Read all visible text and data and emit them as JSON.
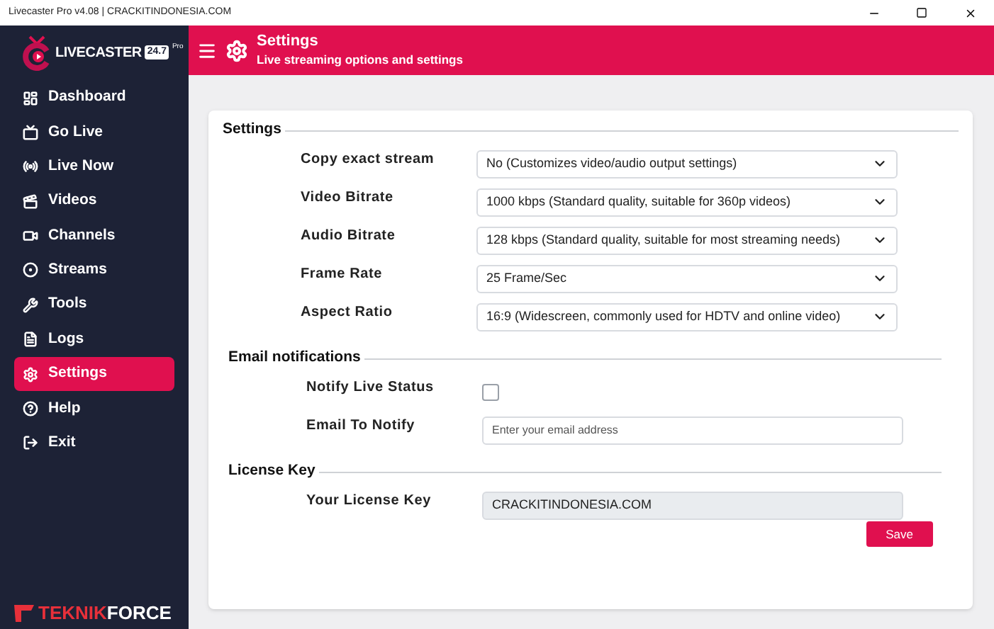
{
  "window": {
    "title": "Livecaster Pro v4.08 | CRACKITINDONESIA.COM"
  },
  "logo": {
    "name": "LIVECASTER",
    "badge": "24.7",
    "tag": "Pro"
  },
  "header": {
    "title": "Settings",
    "subtitle": "Live streaming options and settings"
  },
  "sidebar": {
    "items": [
      {
        "label": "Dashboard",
        "kind": "dashboard",
        "selected": false
      },
      {
        "label": "Go Live",
        "kind": "golive",
        "selected": false
      },
      {
        "label": "Live Now",
        "kind": "livenow",
        "selected": false
      },
      {
        "label": "Videos",
        "kind": "videos",
        "selected": false
      },
      {
        "label": "Channels",
        "kind": "channels",
        "selected": false
      },
      {
        "label": "Streams",
        "kind": "streams",
        "selected": false
      },
      {
        "label": "Tools",
        "kind": "tools",
        "selected": false
      },
      {
        "label": "Logs",
        "kind": "logs",
        "selected": false
      },
      {
        "label": "Settings",
        "kind": "settings",
        "selected": true
      },
      {
        "label": "Help",
        "kind": "help",
        "selected": false
      },
      {
        "label": "Exit",
        "kind": "exit",
        "selected": false
      }
    ],
    "brand": {
      "part1": "TEKNIK",
      "part2": "FORCE"
    }
  },
  "sections": [
    {
      "title": "Settings",
      "rows": [
        {
          "label": "Copy exact stream",
          "kind": "select",
          "value": "No (Customizes video/audio output settings)"
        },
        {
          "label": "Video Bitrate",
          "kind": "select",
          "value": "1000 kbps (Standard quality, suitable for 360p videos)"
        },
        {
          "label": "Audio Bitrate",
          "kind": "select",
          "value": "128 kbps (Standard quality, suitable for most streaming needs)"
        },
        {
          "label": "Frame Rate",
          "kind": "select",
          "value": "25 Frame/Sec"
        },
        {
          "label": "Aspect Ratio",
          "kind": "select",
          "value": "16:9 (Widescreen, commonly used for HDTV and online video)"
        }
      ]
    },
    {
      "title": "Email notifications",
      "rows": [
        {
          "label": "Notify Live Status",
          "kind": "checkbox",
          "checked": false
        },
        {
          "label": "Email To Notify",
          "kind": "input",
          "placeholder": "Enter your email address"
        }
      ]
    },
    {
      "title": "License Key",
      "rows": [
        {
          "label": "Your License Key",
          "kind": "readonly",
          "value": "CRACKITINDONESIA.COM"
        }
      ]
    }
  ],
  "save_button": "Save"
}
